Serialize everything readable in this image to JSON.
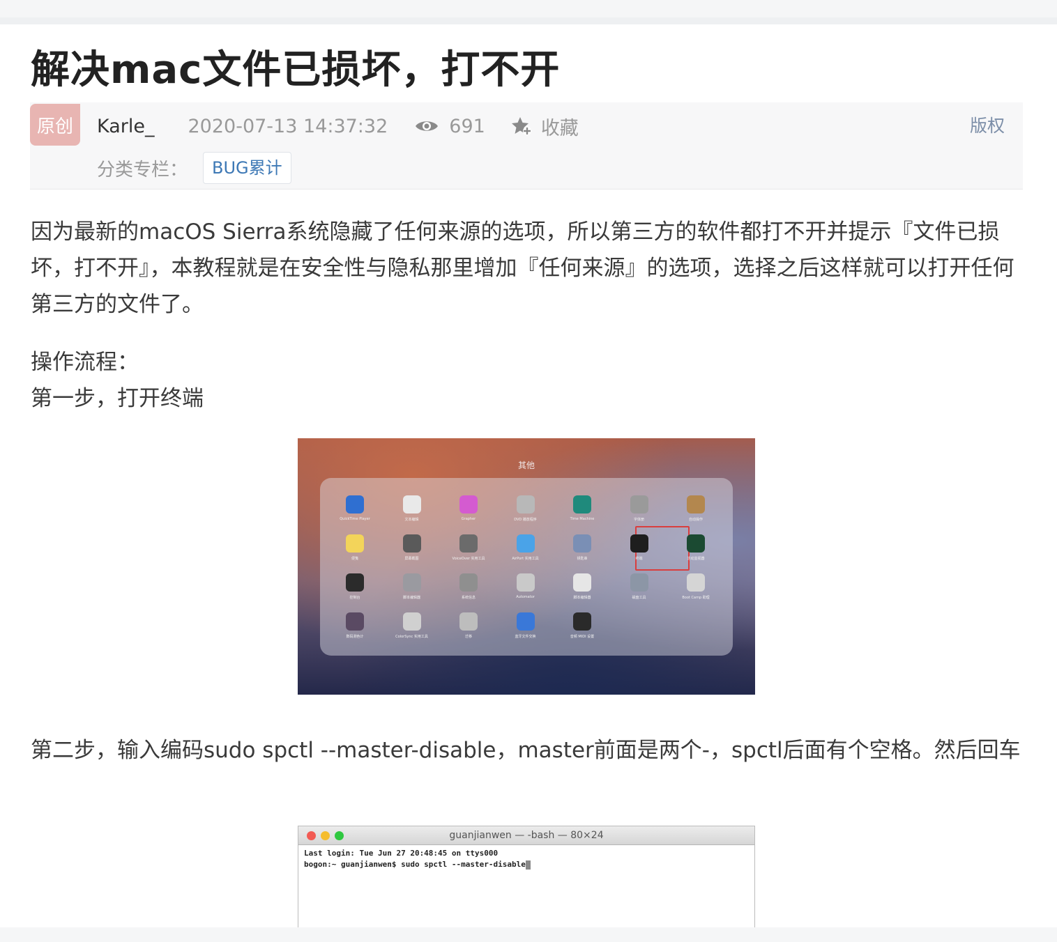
{
  "article": {
    "title": "解决mac文件已损坏，打不开",
    "badge": "原创",
    "author": "Karle_",
    "datetime": "2020-07-13 14:37:32",
    "views": "691",
    "favorite_label": "收藏",
    "copyright_label": "版权",
    "category_label": "分类专栏：",
    "category_tag": "BUG累计"
  },
  "content": {
    "intro": "因为最新的macOS Sierra系统隐藏了任何来源的选项，所以第三方的软件都打不开并提示『文件已损坏，打不开』，本教程就是在安全性与隐私那里增加『任何来源』的选项，选择之后这样就可以打开任何第三方的文件了。",
    "process_label": "操作流程：",
    "step1": "第一步，打开终端",
    "step2": "第二步，输入编码sudo spctl --master-disable，master前面是两个-，spctl后面有个空格。然后回车"
  },
  "launchpad": {
    "folder_title": "其他",
    "apps": [
      {
        "name": "QuickTime Player",
        "color": "#2f6fd1",
        "icon": "quicktime-icon"
      },
      {
        "name": "文本编辑",
        "color": "#e9e9e9",
        "icon": "textedit-icon"
      },
      {
        "name": "Grapher",
        "color": "#d45bd0",
        "icon": "grapher-icon"
      },
      {
        "name": "DVD 播放程序",
        "color": "#b8b8b8",
        "icon": "dvd-icon"
      },
      {
        "name": "Time Machine",
        "color": "#1f8a7c",
        "icon": "time-machine-icon"
      },
      {
        "name": "字体册",
        "color": "#9a9a9a",
        "icon": "fontbook-icon"
      },
      {
        "name": "自动操作",
        "color": "#b3874e",
        "icon": "automator-icon"
      },
      {
        "name": "便笺",
        "color": "#f3d45a",
        "icon": "stickies-icon"
      },
      {
        "name": "屏幕截图",
        "color": "#5a5a5a",
        "icon": "screenshot-icon"
      },
      {
        "name": "VoiceOver 实用工具",
        "color": "#6b6b6b",
        "icon": "voiceover-icon"
      },
      {
        "name": "AirPort 实用工具",
        "color": "#4aa3e8",
        "icon": "airport-icon"
      },
      {
        "name": "钥匙串",
        "color": "#7a8fb5",
        "icon": "keychain-icon"
      },
      {
        "name": "终端",
        "color": "#1e1e1e",
        "icon": "terminal-icon"
      },
      {
        "name": "活动监视器",
        "color": "#1b4a32",
        "icon": "activity-monitor-icon"
      },
      {
        "name": "控制台",
        "color": "#2b2b2b",
        "icon": "console-icon"
      },
      {
        "name": "脚本编辑器",
        "color": "#9a9aa0",
        "icon": "script-editor-icon"
      },
      {
        "name": "系统信息",
        "color": "#8f8f8f",
        "icon": "system-info-icon"
      },
      {
        "name": "Automator",
        "color": "#c9c9c9",
        "icon": "automator-robot-icon"
      },
      {
        "name": "脚本编辑器",
        "color": "#e6e6e6",
        "icon": "script-icon"
      },
      {
        "name": "磁盘工具",
        "color": "#8c96a6",
        "icon": "disk-utility-icon"
      },
      {
        "name": "Boot Camp 助理",
        "color": "#d5d5d5",
        "icon": "bootcamp-icon"
      },
      {
        "name": "数码测色计",
        "color": "#5a4a63",
        "icon": "colorimeter-icon"
      },
      {
        "name": "ColorSync 实用工具",
        "color": "#d0d0d0",
        "icon": "colorsync-icon"
      },
      {
        "name": "迁移",
        "color": "#bdbdbd",
        "icon": "migration-icon"
      },
      {
        "name": "蓝牙文件交换",
        "color": "#3a78d8",
        "icon": "bluetooth-icon"
      },
      {
        "name": "音频 MIDI 设置",
        "color": "#2a2a2a",
        "icon": "midi-icon"
      }
    ]
  },
  "terminal": {
    "title": "guanjianwen — -bash — 80×24",
    "line1": "Last login: Tue Jun 27 20:48:45 on ttys000",
    "line2": "bogon:~ guanjianwen$ sudo spctl --master-disable"
  }
}
